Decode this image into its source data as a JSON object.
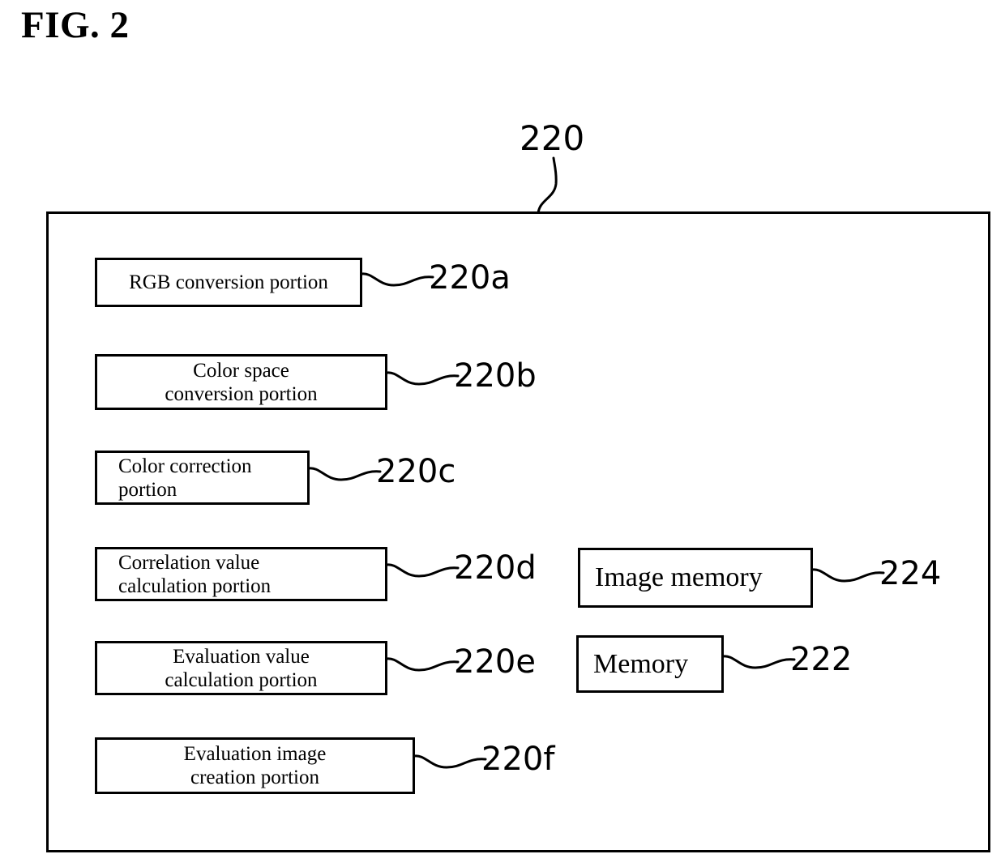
{
  "figure": {
    "title": "FIG. 2",
    "main_reference": "220"
  },
  "colors": {
    "stroke": "#000000",
    "background": "#ffffff"
  },
  "container": {
    "reference": "220"
  },
  "components": [
    {
      "id": "rgb-conversion-portion",
      "reference": "220a",
      "lines": [
        "RGB conversion portion"
      ],
      "align": "center"
    },
    {
      "id": "color-space-conversion-portion",
      "reference": "220b",
      "lines": [
        "Color space",
        "conversion portion"
      ],
      "align": "center"
    },
    {
      "id": "color-correction-portion",
      "reference": "220c",
      "lines": [
        "Color correction",
        "portion"
      ],
      "align": "left"
    },
    {
      "id": "correlation-value-calculation-portion",
      "reference": "220d",
      "lines": [
        "Correlation value",
        "calculation portion"
      ],
      "align": "left"
    },
    {
      "id": "evaluation-value-calculation-portion",
      "reference": "220e",
      "lines": [
        "Evaluation value",
        "calculation portion"
      ],
      "align": "center"
    },
    {
      "id": "evaluation-image-creation-portion",
      "reference": "220f",
      "lines": [
        "Evaluation image",
        "creation portion"
      ],
      "align": "center"
    }
  ],
  "memories": [
    {
      "id": "image-memory",
      "reference": "224",
      "label": "Image memory"
    },
    {
      "id": "memory",
      "reference": "222",
      "label": "Memory"
    }
  ]
}
